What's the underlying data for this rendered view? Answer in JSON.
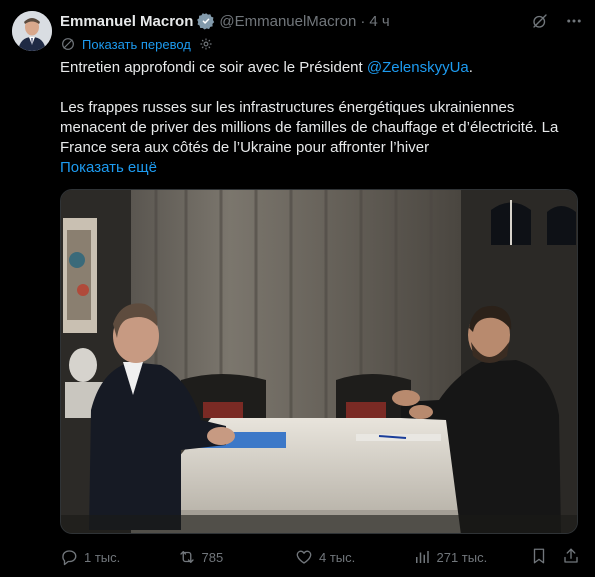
{
  "author": {
    "name": "Emmanuel Macron",
    "handle": "@EmmanuelMacron",
    "separator": "·",
    "time": "4 ч"
  },
  "translate": {
    "label": "Показать перевод"
  },
  "tweet": {
    "line1_text": "Entretien approfondi ce soir avec le Président ",
    "line1_mention": "@ZelenskyyUa",
    "line1_end": ".",
    "paragraph2": "Les frappes russes sur les infrastructures énergétiques ukrainiennes menacent de priver des millions de familles de chauffage et d’électricité. La France sera aux côtés de l’Ukraine pour affronter l’hiver",
    "show_more": "Показать ещё"
  },
  "actions": {
    "replies": "1 тыс.",
    "retweets": "785",
    "likes": "4 тыс.",
    "views": "271 тыс."
  },
  "colors": {
    "background": "#000000",
    "text": "#e7e9ea",
    "muted": "#71767b",
    "accent": "#1d9bf0"
  },
  "icons": [
    "verified-badge-icon",
    "grok-icon",
    "more-icon",
    "translate-icon",
    "gear-icon",
    "reply-icon",
    "retweet-icon",
    "like-icon",
    "views-icon",
    "bookmark-icon",
    "share-icon"
  ]
}
